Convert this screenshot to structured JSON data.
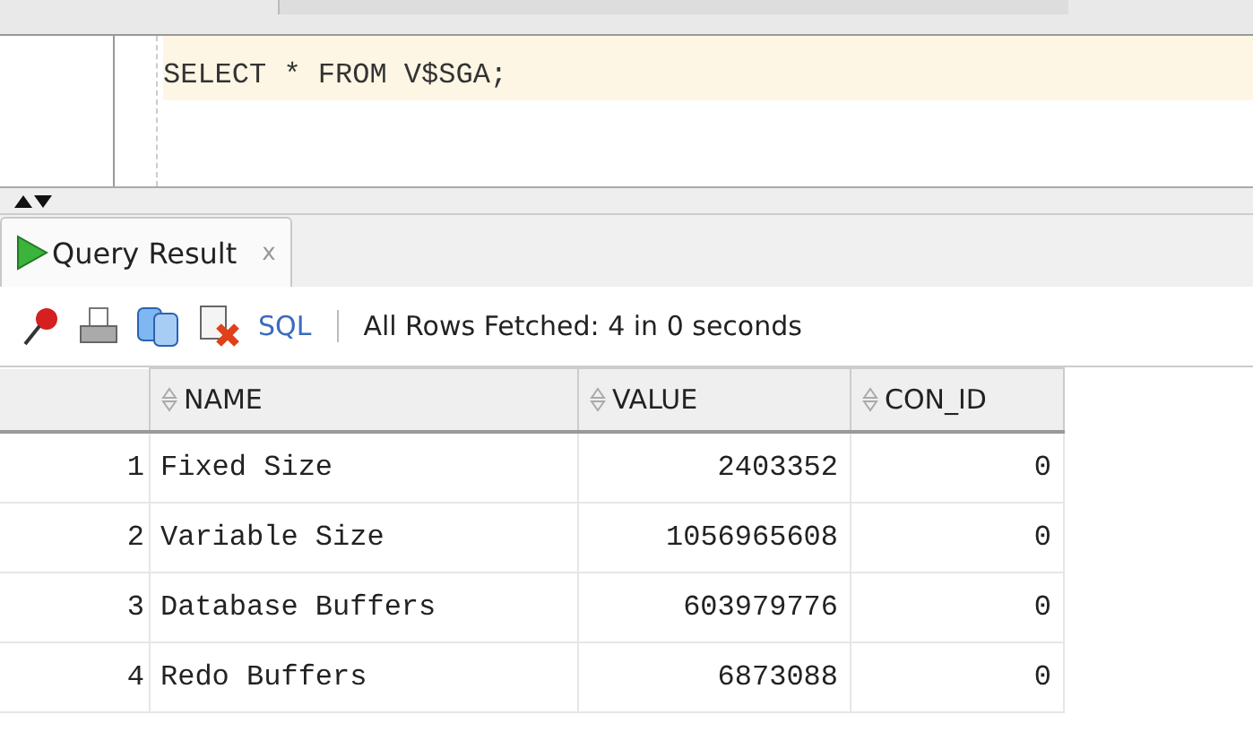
{
  "editor": {
    "sql": "SELECT * FROM V$SGA;"
  },
  "result_tab": {
    "label": "Query Result",
    "close": "x",
    "selected": true
  },
  "toolbar": {
    "sql_link": "SQL",
    "status": "All Rows Fetched: 4 in 0 seconds"
  },
  "table": {
    "columns": [
      "NAME",
      "VALUE",
      "CON_ID"
    ],
    "rows": [
      {
        "num": "1",
        "cells": [
          "Fixed Size",
          "2403352",
          "0"
        ]
      },
      {
        "num": "2",
        "cells": [
          "Variable Size",
          "1056965608",
          "0"
        ]
      },
      {
        "num": "3",
        "cells": [
          "Database Buffers",
          "603979776",
          "0"
        ]
      },
      {
        "num": "4",
        "cells": [
          "Redo Buffers",
          "6873088",
          "0"
        ]
      }
    ]
  }
}
